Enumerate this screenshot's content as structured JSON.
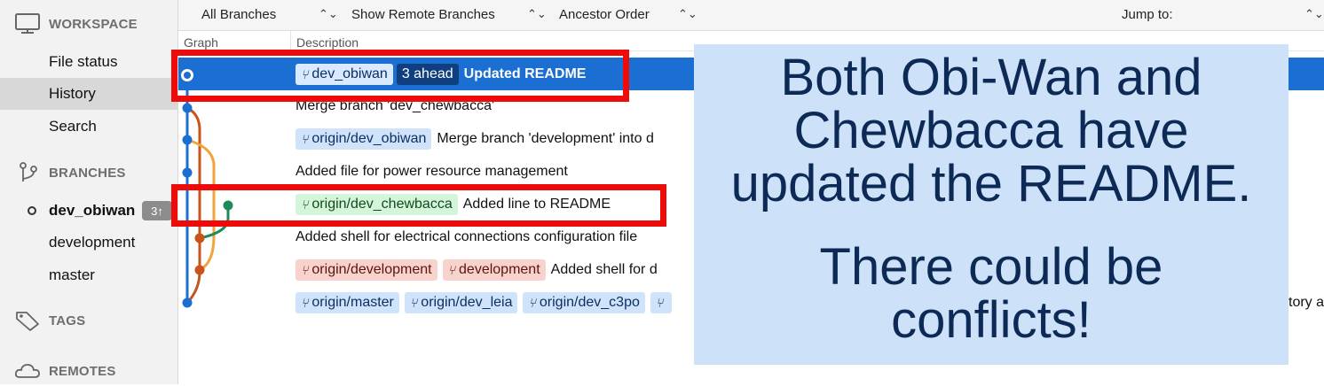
{
  "sidebar": {
    "workspace": {
      "heading": "WORKSPACE",
      "items": [
        {
          "label": "File status"
        },
        {
          "label": "History"
        },
        {
          "label": "Search"
        }
      ]
    },
    "branches": {
      "heading": "BRANCHES",
      "items": [
        {
          "label": "dev_obiwan",
          "badge": "3↑",
          "current": true
        },
        {
          "label": "development"
        },
        {
          "label": "master"
        }
      ]
    },
    "tags": {
      "heading": "TAGS"
    },
    "remotes": {
      "heading": "REMOTES"
    }
  },
  "toolbar": {
    "branch_filter": "All Branches",
    "remote_filter": "Show Remote Branches",
    "order": "Ancestor Order",
    "jump_to": "Jump to:",
    "arrow": "⌃⌄"
  },
  "columns": {
    "graph": "Graph",
    "description": "Description"
  },
  "commits": [
    {
      "tags": [
        {
          "text": "dev_obiwan",
          "style": "light-sel"
        },
        {
          "text": "3 ahead",
          "style": "dark"
        }
      ],
      "message": "Updated README",
      "selected": true
    },
    {
      "tags": [],
      "message": "Merge branch 'dev_chewbacca'"
    },
    {
      "tags": [
        {
          "text": "origin/dev_obiwan",
          "style": "blue"
        }
      ],
      "message": "Merge branch 'development' into d"
    },
    {
      "tags": [],
      "message": "Added file for power resource management"
    },
    {
      "tags": [
        {
          "text": "origin/dev_chewbacca",
          "style": "green"
        }
      ],
      "message": "Added line to README"
    },
    {
      "tags": [],
      "message": "Added shell for electrical connections configuration file"
    },
    {
      "tags": [
        {
          "text": "origin/development",
          "style": "red"
        },
        {
          "text": "development",
          "style": "red"
        }
      ],
      "message": "Added shell for d"
    },
    {
      "tags": [
        {
          "text": "origin/master",
          "style": "blue"
        },
        {
          "text": "origin/dev_leia",
          "style": "blue"
        },
        {
          "text": "origin/dev_c3po",
          "style": "blue"
        },
        {
          "text": "",
          "style": "blue"
        }
      ],
      "message": ""
    }
  ],
  "right_overflow_text": "tory a",
  "callout": {
    "line1": "Both Obi-Wan and",
    "line2": "Chewbacca have",
    "line3": "updated the README.",
    "line4": "There could be",
    "line5": "conflicts!"
  },
  "colors": {
    "selection": "#1b6ed2",
    "annotation_border": "#f00b0b",
    "callout_bg": "#cde2f8",
    "graph_blue": "#1b6ed2",
    "graph_orange": "#f2a33a",
    "graph_rust": "#c8531b",
    "graph_green": "#1e8a5a"
  }
}
